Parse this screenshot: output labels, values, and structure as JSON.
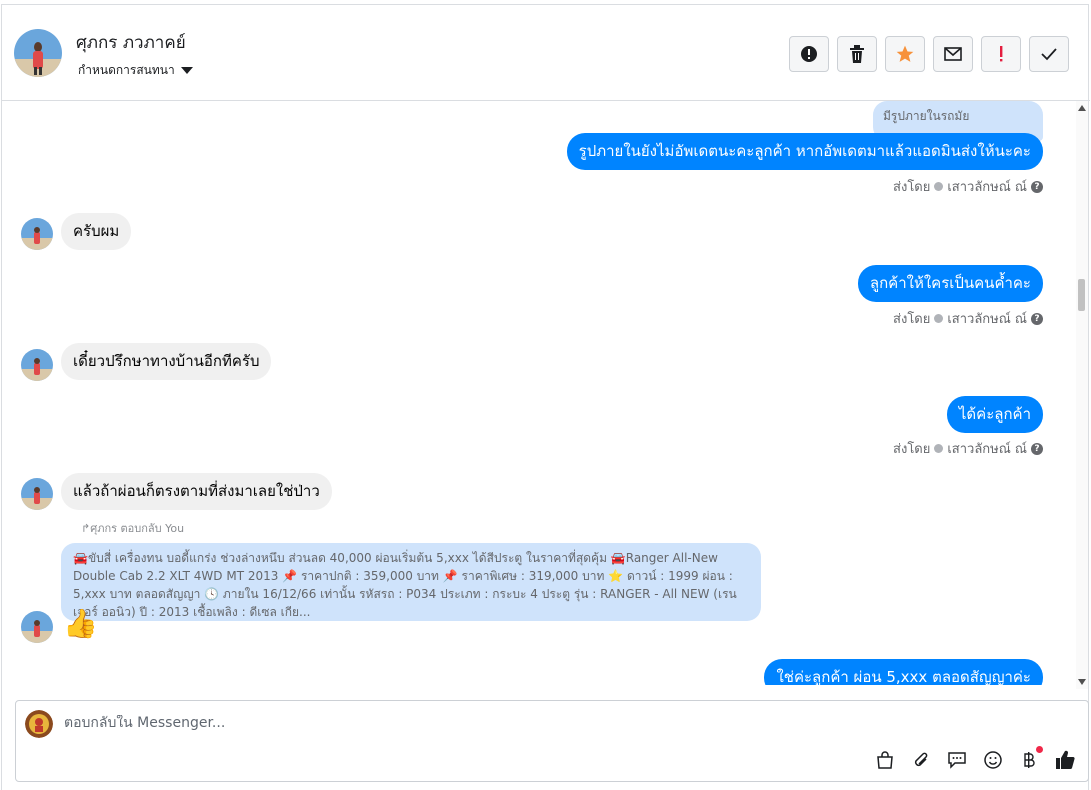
{
  "header": {
    "contact_name": "ศุภกร ภวภาคย์",
    "assign_label": "กำหนดการสนทนา",
    "actions": [
      {
        "icon": "alert-circle-icon"
      },
      {
        "icon": "trash-icon"
      },
      {
        "icon": "star-icon",
        "color": "#f7923b"
      },
      {
        "icon": "envelope-icon"
      },
      {
        "icon": "exclamation-icon",
        "color": "#e41e3f"
      },
      {
        "icon": "check-icon"
      }
    ]
  },
  "conversation": {
    "quoted_top": "มีรูปภายในรถมัย",
    "sent_by_label": "ส่งโดย",
    "agent_name": "เสาวลักษณ์ ณ์",
    "messages": [
      {
        "from": "agent",
        "text": "รูปภายในยังไม่อัพเดตนะคะลูกค้า หากอัพเดตมาแล้วแอดมินส่งให้นะคะ"
      },
      {
        "from": "customer",
        "text": "ครับผม"
      },
      {
        "from": "agent",
        "text": "ลูกค้าให้ใครเป็นคนค้ำคะ"
      },
      {
        "from": "customer",
        "text": "เดี๋ยวปรึกษาทางบ้านอีกทีครับ"
      },
      {
        "from": "agent",
        "text": "ได้ค่ะลูกค้า"
      },
      {
        "from": "customer",
        "text": "แล้วถ้าผ่อนก็ตรงตามที่ส่งมาเลยใช่ป่าว"
      },
      {
        "from": "agent",
        "text": "ใช่ค่ะลูกค้า ผ่อน 5,xxx ตลอดสัญญาค่ะ"
      }
    ],
    "reply_label": "↱ศุภกร ตอบกลับ You",
    "quoted_message": "🚘ขับสี่ เครื่องทน บอดี้แกร่ง ช่วงล่างหนึบ ส่วนลด 40,000 ผ่อนเริ่มต้น 5,xxx ได้สีประตู ในราคาที่สุดคุ้ม 🚘Ranger All-New Double Cab 2.2 XLT 4WD MT 2013 📌 ราคาปกติ : 359,000 บาท 📌 ราคาพิเศษ : 319,000 บาท ⭐ ดาวน์ : 1999 ผ่อน : 5,xxx บาท ตลอดสัญญา 🕓 ภายใน 16/12/66 เท่านั้น รหัสรถ : P034 ประเภท : กระบะ 4 ประตู รุ่น : RANGER - All NEW (เรนเจอร์ ออนิว) ปี : 2013 เชื้อเพลิง : ดีเซล เกีย...",
    "reaction": "👍"
  },
  "composer": {
    "placeholder": "ตอบกลับใน Messenger...",
    "tools": [
      "shopping-bag-icon",
      "paperclip-icon",
      "chat-bubble-icon",
      "smiley-icon",
      "baht-icon",
      "thumbs-up-icon"
    ],
    "like_color": "#1c1e21"
  }
}
